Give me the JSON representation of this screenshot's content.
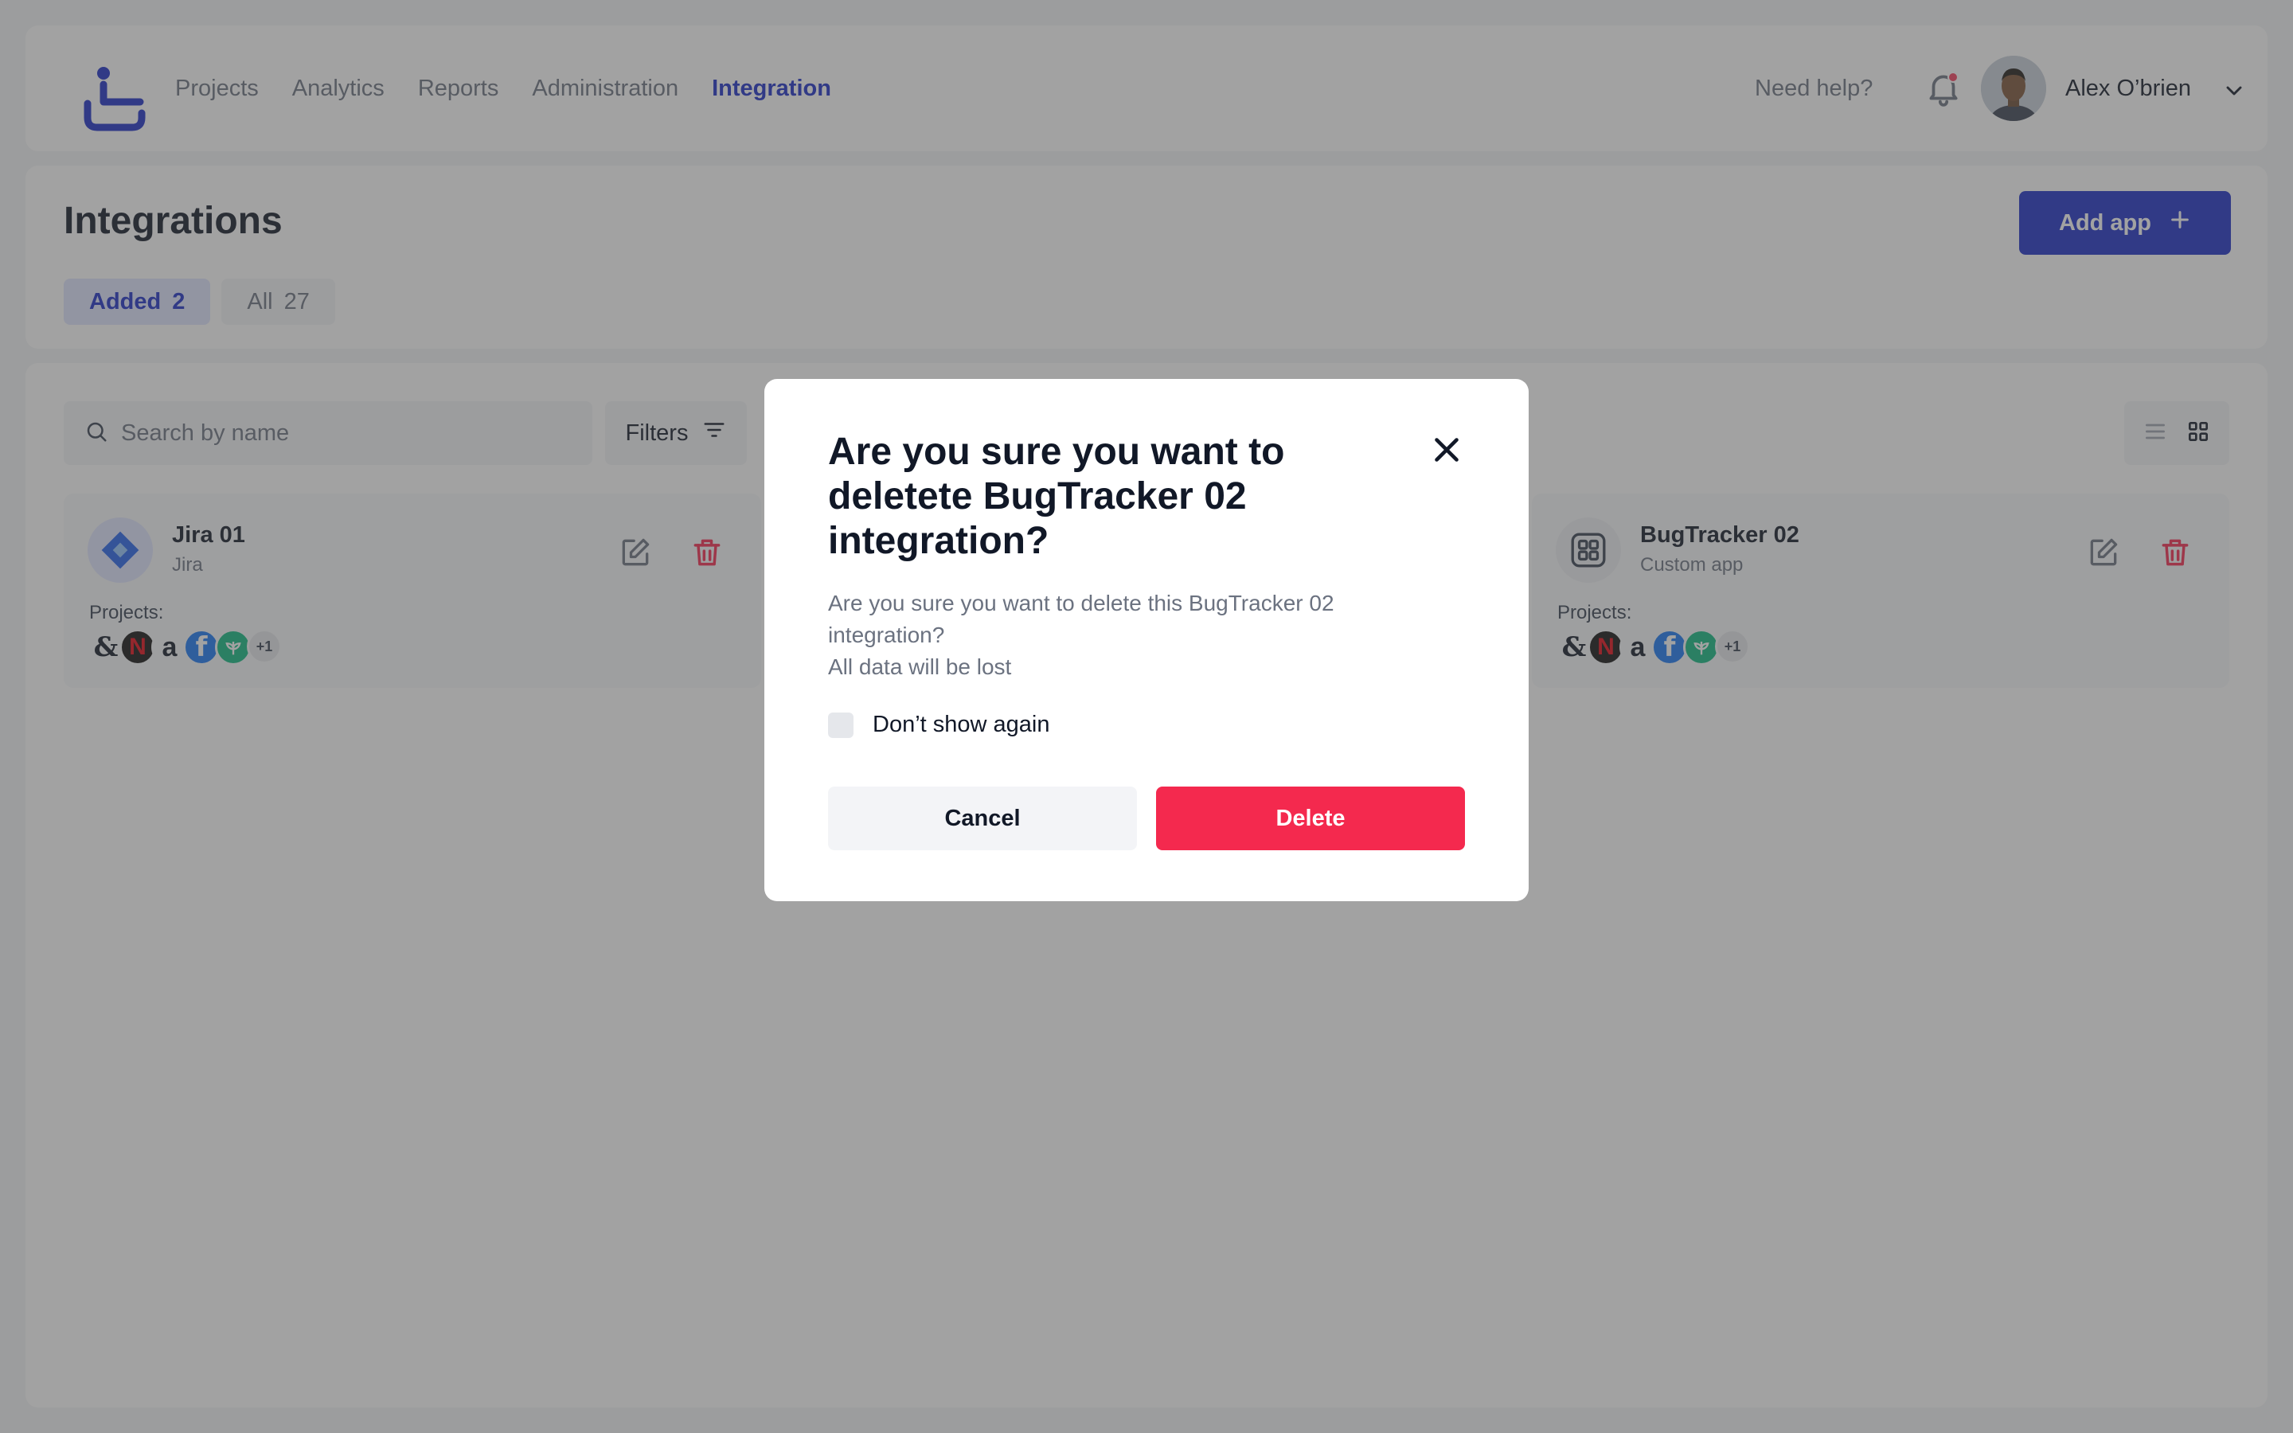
{
  "nav": {
    "items": [
      {
        "label": "Projects",
        "active": false
      },
      {
        "label": "Analytics",
        "active": false
      },
      {
        "label": "Reports",
        "active": false
      },
      {
        "label": "Administration",
        "active": false
      },
      {
        "label": "Integration",
        "active": true
      }
    ],
    "help_label": "Need help?",
    "user_name": "Alex O’brien",
    "notification_icon": "bell-icon",
    "has_unread_notifications": true
  },
  "header": {
    "title": "Integrations",
    "add_button_label": "Add app",
    "tabs": [
      {
        "label": "Added",
        "count": "2",
        "active": true
      },
      {
        "label": "All",
        "count": "27",
        "active": false
      }
    ]
  },
  "toolbar": {
    "search_placeholder": "Search by name",
    "filters_label": "Filters",
    "view_mode": "grid"
  },
  "cards": [
    {
      "name": "Jira 01",
      "type": "Jira",
      "icon": "jira-icon",
      "projects_label": "Projects:",
      "projects": [
        "&",
        "N",
        "a",
        "f",
        "leaf"
      ],
      "more_count": "+1"
    },
    {
      "name": "BugTracker 02",
      "type": "Custom app",
      "icon": "custom-app-icon",
      "projects_label": "Projects:",
      "projects": [
        "&",
        "N",
        "a",
        "f",
        "leaf"
      ],
      "more_count": "+1"
    }
  ],
  "modal": {
    "title": "Are you sure you want to deletete BugTracker 02 integration?",
    "body_line1": "Are you sure you want to delete this BugTracker 02 integration?",
    "body_line2": "All data will be lost",
    "checkbox_label": "Don’t show again",
    "checkbox_checked": false,
    "cancel_label": "Cancel",
    "delete_label": "Delete"
  },
  "colors": {
    "accent": "#1d2fc7",
    "danger": "#f4294e",
    "overlay": "#464646"
  }
}
